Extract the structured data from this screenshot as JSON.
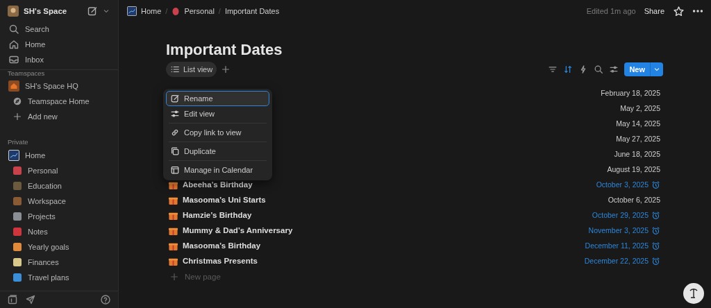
{
  "sidebar": {
    "workspace": "SH's Space",
    "nav": [
      {
        "label": "Search"
      },
      {
        "label": "Home"
      },
      {
        "label": "Inbox"
      }
    ],
    "teamspaces_label": "Teamspaces",
    "teamspaces": [
      {
        "label": "SH's Space HQ",
        "children": [
          {
            "label": "Teamspace Home"
          },
          {
            "label": "Add new"
          }
        ]
      }
    ],
    "private_label": "Private",
    "private": [
      {
        "label": "Home",
        "children": [
          {
            "label": "Personal"
          },
          {
            "label": "Education"
          },
          {
            "label": "Workspace"
          },
          {
            "label": "Projects"
          },
          {
            "label": "Notes"
          },
          {
            "label": "Yearly goals"
          },
          {
            "label": "Finances"
          },
          {
            "label": "Travel plans"
          }
        ]
      }
    ]
  },
  "breadcrumbs": [
    "Home",
    "Personal",
    "Important Dates"
  ],
  "breadcrumb_separators": [
    "/",
    "/"
  ],
  "topbar": {
    "edited": "Edited 1m ago",
    "share": "Share"
  },
  "page": {
    "title": "Important Dates",
    "view_tab": {
      "label": "List view",
      "selected": true
    },
    "sort_active": true,
    "new_button": "New",
    "rows": [
      {
        "date": "February 18, 2025",
        "reminder": false
      },
      {
        "date": "May 2, 2025",
        "reminder": false
      },
      {
        "date": "May 14, 2025",
        "reminder": false
      },
      {
        "date": "May 27, 2025",
        "reminder": false
      },
      {
        "date": "June 18, 2025",
        "reminder": false
      },
      {
        "date": "August 19, 2025",
        "reminder": false
      },
      {
        "title": "Abeeha’s Birthday",
        "date": "October 3, 2025",
        "reminder": true
      },
      {
        "title": "Masooma’s Uni Starts",
        "date": "October 6, 2025",
        "reminder": false
      },
      {
        "title": "Hamzie’s Birthday",
        "date": "October 29, 2025",
        "reminder": true
      },
      {
        "title": "Mummy & Dad’s Anniversary",
        "date": "November 3, 2025",
        "reminder": true
      },
      {
        "title": "Masooma’s Birthday",
        "date": "December 11, 2025",
        "reminder": true
      },
      {
        "title": "Christmas Presents",
        "date": "December 22, 2025",
        "reminder": true
      }
    ],
    "new_page": "New page"
  },
  "menu": [
    {
      "label": "Rename",
      "selected": true,
      "separated": false
    },
    {
      "label": "Edit view",
      "selected": false,
      "separated": false
    },
    {
      "label": "Copy link to view",
      "selected": false,
      "separated": true
    },
    {
      "label": "Duplicate",
      "selected": false,
      "separated": true
    },
    {
      "label": "Manage in Calendar",
      "selected": false,
      "separated": true
    }
  ]
}
